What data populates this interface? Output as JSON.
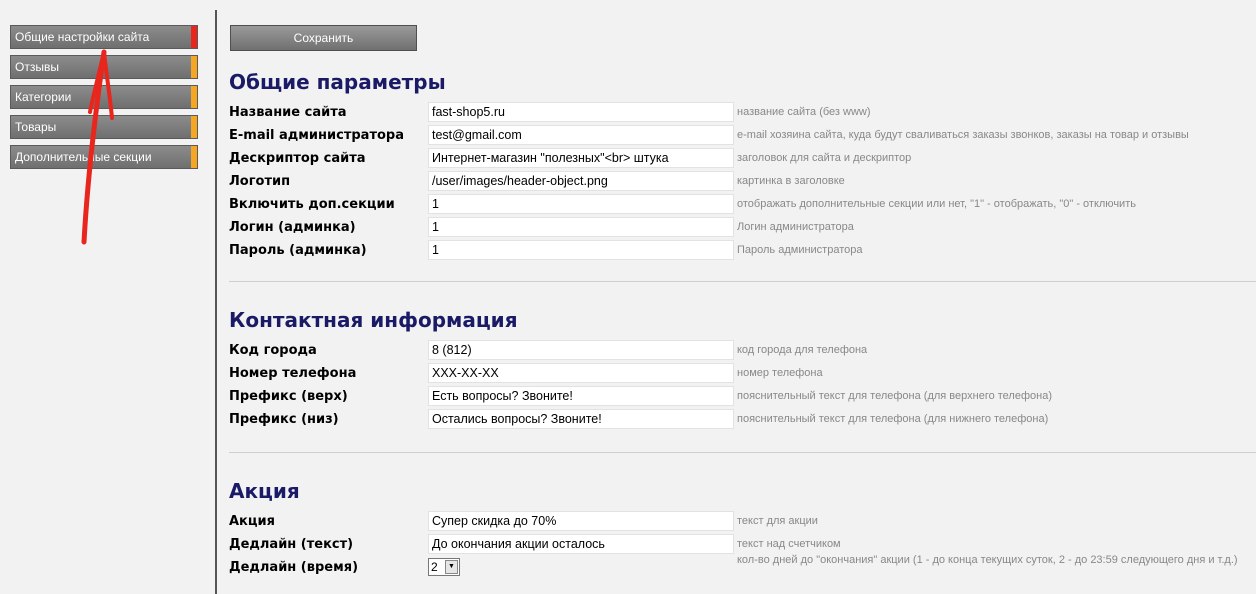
{
  "sidebar": {
    "items": [
      {
        "label": "Общие настройки сайта",
        "active": true
      },
      {
        "label": "Отзывы",
        "active": false
      },
      {
        "label": "Категории",
        "active": false
      },
      {
        "label": "Товары",
        "active": false
      },
      {
        "label": "Дополнительные секции",
        "active": false
      }
    ]
  },
  "toolbar": {
    "save_label": "Сохранить"
  },
  "sections": {
    "general": {
      "title": "Общие параметры",
      "rows": [
        {
          "label": "Название сайта",
          "value": "fast-shop5.ru",
          "hint": "название сайта (без www)"
        },
        {
          "label": "E-mail администратора",
          "value": "test@gmail.com",
          "hint": "e-mail хозяина сайта, куда будут сваливаться заказы звонков, заказы на товар и отзывы"
        },
        {
          "label": "Дескриптор сайта",
          "value": "Интернет-магазин \"полезных\"<br> штука",
          "hint": "заголовок для сайта и дескриптор"
        },
        {
          "label": "Логотип",
          "value": "/user/images/header-object.png",
          "hint": "картинка в заголовке"
        },
        {
          "label": "Включить доп.секции",
          "value": "1",
          "hint": "отображать дополнительные секции или нет, \"1\" - отображать, \"0\" - отключить"
        },
        {
          "label": "Логин (админка)",
          "value": "1",
          "hint": "Логин администратора"
        },
        {
          "label": "Пароль (админка)",
          "value": "1",
          "hint": "Пароль администратора"
        }
      ]
    },
    "contacts": {
      "title": "Контактная информация",
      "rows": [
        {
          "label": "Код города",
          "value": "8 (812)",
          "hint": "код города для телефона"
        },
        {
          "label": "Номер телефона",
          "value": "XXX-XX-XX",
          "hint": "номер телефона"
        },
        {
          "label": "Префикс (верх)",
          "value": "Есть вопросы? Звоните!",
          "hint": "пояснительный текст для телефона (для верхнего телефона)"
        },
        {
          "label": "Префикс (низ)",
          "value": "Остались вопросы? Звоните!",
          "hint": "пояснительный текст для телефона (для нижнего телефона)"
        }
      ]
    },
    "promo": {
      "title": "Акция",
      "rows": [
        {
          "label": "Акция",
          "value": "Супер скидка до 70%",
          "hint": "текст для акции"
        },
        {
          "label": "Дедлайн (текст)",
          "value": "До окончания акции осталось",
          "hint": "текст над счетчиком"
        },
        {
          "label": "Дедлайн (время)",
          "value": "2",
          "hint": "кол-во дней до \"окончания\" акции (1 - до конца текущих суток, 2 - до 23:59 следующего дня и т.д.)"
        }
      ]
    }
  },
  "colors": {
    "accent_active": "#e8261d",
    "accent": "#f5a623",
    "heading": "#1a1a66",
    "annotation": "#e8261d"
  }
}
